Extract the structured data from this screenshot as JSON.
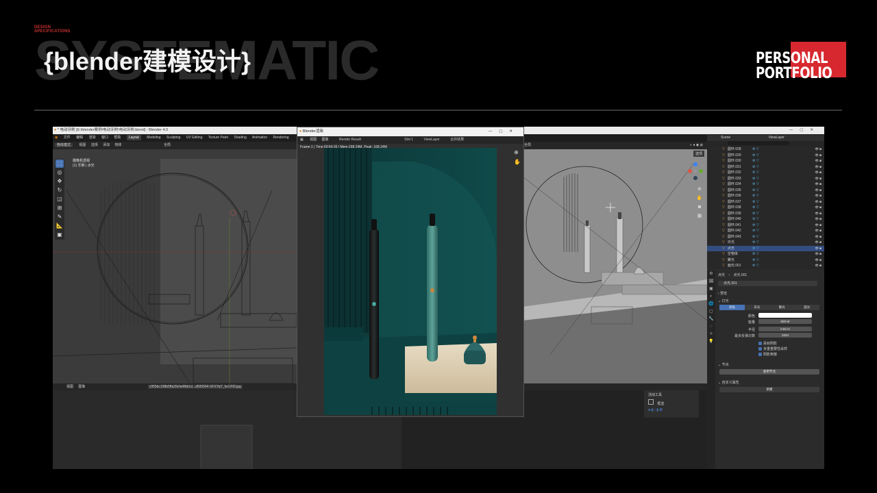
{
  "header": {
    "design_spec_line1": "DESIGN",
    "design_spec_line2": "SPECIFICATIONS",
    "bg_word": "SYSTEMATIC",
    "title": "{blender建模设计}",
    "portfolio_line1": "PERSONAL",
    "portfolio_line2": "PORTFOLIO"
  },
  "blender": {
    "window_title": "* 电动牙刷 [E:\\blender案例\\电动牙刷\\电动牙刷.blend] - Blender 4.0",
    "menu": [
      "文件",
      "编辑",
      "渲染",
      "窗口",
      "帮助"
    ],
    "workspaces": [
      "Layout",
      "Modeling",
      "Sculpting",
      "UV Editing",
      "Texture Paint",
      "Shading",
      "Animation",
      "Rendering"
    ],
    "viewport_header": {
      "mode": "物体模式",
      "items": [
        "视图",
        "选择",
        "添加",
        "物体"
      ],
      "transform": "全局"
    },
    "viewport_info": {
      "line1": "摄像机透视",
      "line2": "(1) 牙刷 | 点光"
    },
    "image_editor": {
      "items": [
        "视图",
        "图像"
      ],
      "filename": "c955bc198b5ffa39cfa4fbb1d...d595594-SFXYqY_fw1200.jpg"
    },
    "render_window": {
      "title": "Blender渲染",
      "menu": [
        "视图",
        "图像"
      ],
      "result": "Render Result",
      "slot": "Slot 1",
      "view_layer": "ViewLayer",
      "composite": "合并结果",
      "frame_info": "Frame:1 | Time:00:54.93 | Mem:168.24M, Peak: 168.24M"
    },
    "right_viewport": {
      "transform": "全局",
      "select_label": "选项"
    },
    "outliner": {
      "scene": "Scene",
      "view_layer": "ViewLayer",
      "items": [
        {
          "name": "圆环.028",
          "selected": false
        },
        {
          "name": "圆环.029",
          "selected": false
        },
        {
          "name": "圆环.030",
          "selected": false
        },
        {
          "name": "圆环.031",
          "selected": false
        },
        {
          "name": "圆环.032",
          "selected": false
        },
        {
          "name": "圆环.033",
          "selected": false
        },
        {
          "name": "圆环.034",
          "selected": false
        },
        {
          "name": "圆环.035",
          "selected": false
        },
        {
          "name": "圆环.036",
          "selected": false
        },
        {
          "name": "圆环.037",
          "selected": false
        },
        {
          "name": "圆环.038",
          "selected": false
        },
        {
          "name": "圆环.039",
          "selected": false
        },
        {
          "name": "圆环.040",
          "selected": false
        },
        {
          "name": "圆环.041",
          "selected": false
        },
        {
          "name": "圆环.042",
          "selected": false
        },
        {
          "name": "圆环.043",
          "selected": false
        },
        {
          "name": "日光",
          "selected": false
        },
        {
          "name": "点光",
          "selected": true
        },
        {
          "name": "空物体",
          "selected": false
        },
        {
          "name": "聚光",
          "selected": false
        },
        {
          "name": "面光.001",
          "selected": false
        }
      ]
    },
    "properties": {
      "breadcrumb_a": "点光",
      "breadcrumb_b": "点光.001",
      "data_name": "点光.001",
      "section_preview": "预览",
      "section_light": "灯光",
      "light_types": [
        "点光",
        "日光",
        "聚光",
        "面光"
      ],
      "color_label": "颜色",
      "power_label": "能量",
      "power_value": "500 W",
      "radius_label": "半径",
      "radius_value": "0.84 m",
      "bounces_label": "最多反弹次数",
      "bounces_value": "1024",
      "cast_shadow": "投射阴影",
      "mis": "多重重要性采样",
      "shadow_caustics": "阴影焦散",
      "section_nodes": "节点",
      "use_nodes": "使用节点",
      "section_custom": "自定义属性",
      "new_button": "新建"
    },
    "active_tool": {
      "title": "活动工具",
      "tool": "框选"
    }
  }
}
